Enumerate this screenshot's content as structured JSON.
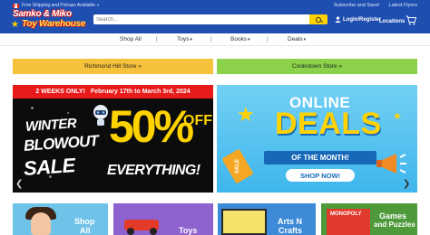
{
  "topbar": {
    "shipping_text": "Free Shipping and Pickups Available »",
    "subscribe": "Subscribe and Save!",
    "latest_flyers": "Latest Flyers"
  },
  "logo": {
    "line1": "Samko & Miko",
    "line2": "Toy Warehouse"
  },
  "search": {
    "placeholder": "Search..."
  },
  "header": {
    "login_label": "Login/Register",
    "locations_label": "Locations"
  },
  "nav": {
    "items": [
      {
        "label": "Shop All"
      },
      {
        "label": "Toys"
      },
      {
        "label": "Books"
      },
      {
        "label": "Deals"
      }
    ],
    "separator": "|"
  },
  "stores": {
    "richmond_hill": "Richmond Hill Store »",
    "cookstown": "Cookstown Store »"
  },
  "winter_banner": {
    "top_left": "2 WEEKS ONLY!",
    "top_right": "February 17th to March 3rd, 2024",
    "winter": "WINTER",
    "blowout": "BLOWOUT",
    "sale": "SALE",
    "percent": "50%",
    "off": "OFF",
    "everything": "EVERYTHING!"
  },
  "deals_banner": {
    "online": "ONLINE",
    "deals": "DEALS",
    "of_the_month": "OF THE MONTH!",
    "shop_now": "SHOP NOW!",
    "sale_tag": "SALE"
  },
  "tiles": [
    {
      "label_line1": "Shop",
      "label_line2": "All"
    },
    {
      "label_line1": "Toys",
      "label_line2": ""
    },
    {
      "label_line1": "Arts N",
      "label_line2": "Crafts"
    },
    {
      "label_line1": "Games",
      "label_line2": "and Puzzles"
    }
  ],
  "colors": {
    "header_blue": "#1e4fb0",
    "search_button": "#ffd200",
    "richmond_hill_button": "#f7c23b",
    "cookstown_button": "#8bd14a",
    "sale_red": "#e81a1a",
    "deals_sky": "#3fb6ec"
  },
  "icons": {
    "flag": "canada-flag-icon",
    "search": "search-icon",
    "user": "user-icon",
    "cart": "cart-icon",
    "prev": "chevron-left-icon",
    "next": "chevron-right-icon"
  }
}
